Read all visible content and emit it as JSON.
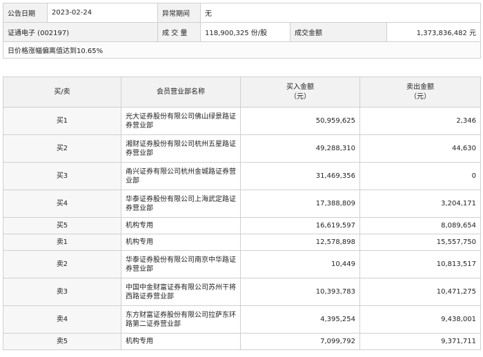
{
  "info": {
    "date_label": "公告日期",
    "date_value": "2023-02-24",
    "period_label": "异常期间",
    "period_value": "无",
    "stock": "证通电子 (002197)",
    "volume_label": "成 交 量",
    "volume_value": "118,900,325 份/股",
    "amount_label": "成交金额",
    "amount_value": "1,373,836,482 元",
    "notice": "日价格涨幅偏离值达到10.65%"
  },
  "table": {
    "headers": {
      "side": "买/卖",
      "name": "会员营业部名称",
      "buy_line1": "买入金额",
      "buy_line2": "（元）",
      "sell_line1": "卖出金额",
      "sell_line2": "（元）"
    },
    "rows": [
      {
        "side": "买1",
        "name": "光大证券股份有限公司佛山绿景路证券营业部",
        "buy": "50,959,625",
        "sell": "2,346"
      },
      {
        "side": "买2",
        "name": "湘财证券股份有限公司杭州五星路证券营业部",
        "buy": "49,288,310",
        "sell": "44,630"
      },
      {
        "side": "买3",
        "name": "甬兴证券有限公司杭州金城路证券营业部",
        "buy": "31,469,356",
        "sell": "0"
      },
      {
        "side": "买4",
        "name": "华泰证券股份有限公司上海武定路证券营业部",
        "buy": "17,388,809",
        "sell": "3,204,171"
      },
      {
        "side": "买5",
        "name": "机构专用",
        "buy": "16,619,597",
        "sell": "8,089,654"
      },
      {
        "side": "卖1",
        "name": "机构专用",
        "buy": "12,578,898",
        "sell": "15,557,750"
      },
      {
        "side": "卖2",
        "name": "华泰证券股份有限公司南京中华路证券营业部",
        "buy": "10,449",
        "sell": "10,813,517"
      },
      {
        "side": "卖3",
        "name": "中国中金财富证券有限公司苏州干将西路证券营业部",
        "buy": "10,393,783",
        "sell": "10,471,275"
      },
      {
        "side": "卖4",
        "name": "东方财富证券股份有限公司拉萨东环路第二证券营业部",
        "buy": "4,395,254",
        "sell": "9,438,001"
      },
      {
        "side": "卖5",
        "name": "机构专用",
        "buy": "7,099,792",
        "sell": "9,371,711"
      }
    ]
  }
}
